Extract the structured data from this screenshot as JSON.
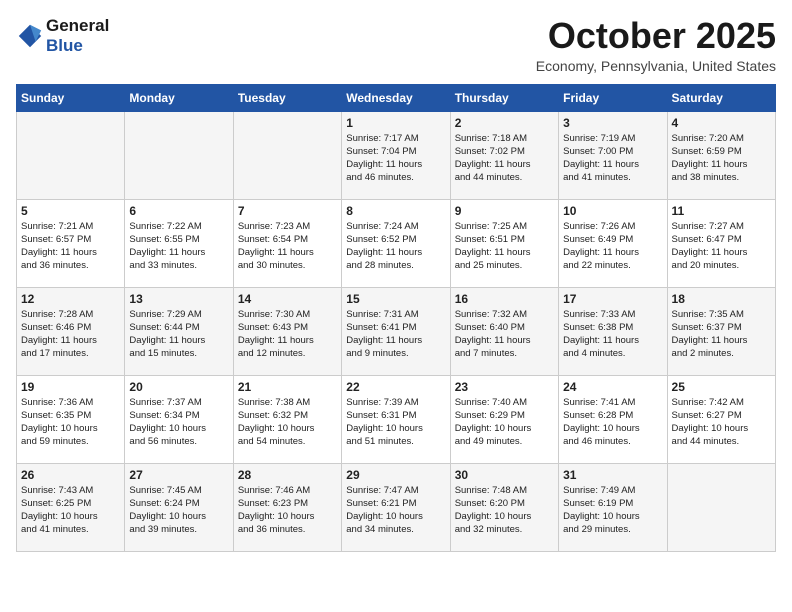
{
  "header": {
    "logo_line1": "General",
    "logo_line2": "Blue",
    "month_title": "October 2025",
    "location": "Economy, Pennsylvania, United States"
  },
  "days_of_week": [
    "Sunday",
    "Monday",
    "Tuesday",
    "Wednesday",
    "Thursday",
    "Friday",
    "Saturday"
  ],
  "weeks": [
    [
      {
        "day": "",
        "info": ""
      },
      {
        "day": "",
        "info": ""
      },
      {
        "day": "",
        "info": ""
      },
      {
        "day": "1",
        "info": "Sunrise: 7:17 AM\nSunset: 7:04 PM\nDaylight: 11 hours\nand 46 minutes."
      },
      {
        "day": "2",
        "info": "Sunrise: 7:18 AM\nSunset: 7:02 PM\nDaylight: 11 hours\nand 44 minutes."
      },
      {
        "day": "3",
        "info": "Sunrise: 7:19 AM\nSunset: 7:00 PM\nDaylight: 11 hours\nand 41 minutes."
      },
      {
        "day": "4",
        "info": "Sunrise: 7:20 AM\nSunset: 6:59 PM\nDaylight: 11 hours\nand 38 minutes."
      }
    ],
    [
      {
        "day": "5",
        "info": "Sunrise: 7:21 AM\nSunset: 6:57 PM\nDaylight: 11 hours\nand 36 minutes."
      },
      {
        "day": "6",
        "info": "Sunrise: 7:22 AM\nSunset: 6:55 PM\nDaylight: 11 hours\nand 33 minutes."
      },
      {
        "day": "7",
        "info": "Sunrise: 7:23 AM\nSunset: 6:54 PM\nDaylight: 11 hours\nand 30 minutes."
      },
      {
        "day": "8",
        "info": "Sunrise: 7:24 AM\nSunset: 6:52 PM\nDaylight: 11 hours\nand 28 minutes."
      },
      {
        "day": "9",
        "info": "Sunrise: 7:25 AM\nSunset: 6:51 PM\nDaylight: 11 hours\nand 25 minutes."
      },
      {
        "day": "10",
        "info": "Sunrise: 7:26 AM\nSunset: 6:49 PM\nDaylight: 11 hours\nand 22 minutes."
      },
      {
        "day": "11",
        "info": "Sunrise: 7:27 AM\nSunset: 6:47 PM\nDaylight: 11 hours\nand 20 minutes."
      }
    ],
    [
      {
        "day": "12",
        "info": "Sunrise: 7:28 AM\nSunset: 6:46 PM\nDaylight: 11 hours\nand 17 minutes."
      },
      {
        "day": "13",
        "info": "Sunrise: 7:29 AM\nSunset: 6:44 PM\nDaylight: 11 hours\nand 15 minutes."
      },
      {
        "day": "14",
        "info": "Sunrise: 7:30 AM\nSunset: 6:43 PM\nDaylight: 11 hours\nand 12 minutes."
      },
      {
        "day": "15",
        "info": "Sunrise: 7:31 AM\nSunset: 6:41 PM\nDaylight: 11 hours\nand 9 minutes."
      },
      {
        "day": "16",
        "info": "Sunrise: 7:32 AM\nSunset: 6:40 PM\nDaylight: 11 hours\nand 7 minutes."
      },
      {
        "day": "17",
        "info": "Sunrise: 7:33 AM\nSunset: 6:38 PM\nDaylight: 11 hours\nand 4 minutes."
      },
      {
        "day": "18",
        "info": "Sunrise: 7:35 AM\nSunset: 6:37 PM\nDaylight: 11 hours\nand 2 minutes."
      }
    ],
    [
      {
        "day": "19",
        "info": "Sunrise: 7:36 AM\nSunset: 6:35 PM\nDaylight: 10 hours\nand 59 minutes."
      },
      {
        "day": "20",
        "info": "Sunrise: 7:37 AM\nSunset: 6:34 PM\nDaylight: 10 hours\nand 56 minutes."
      },
      {
        "day": "21",
        "info": "Sunrise: 7:38 AM\nSunset: 6:32 PM\nDaylight: 10 hours\nand 54 minutes."
      },
      {
        "day": "22",
        "info": "Sunrise: 7:39 AM\nSunset: 6:31 PM\nDaylight: 10 hours\nand 51 minutes."
      },
      {
        "day": "23",
        "info": "Sunrise: 7:40 AM\nSunset: 6:29 PM\nDaylight: 10 hours\nand 49 minutes."
      },
      {
        "day": "24",
        "info": "Sunrise: 7:41 AM\nSunset: 6:28 PM\nDaylight: 10 hours\nand 46 minutes."
      },
      {
        "day": "25",
        "info": "Sunrise: 7:42 AM\nSunset: 6:27 PM\nDaylight: 10 hours\nand 44 minutes."
      }
    ],
    [
      {
        "day": "26",
        "info": "Sunrise: 7:43 AM\nSunset: 6:25 PM\nDaylight: 10 hours\nand 41 minutes."
      },
      {
        "day": "27",
        "info": "Sunrise: 7:45 AM\nSunset: 6:24 PM\nDaylight: 10 hours\nand 39 minutes."
      },
      {
        "day": "28",
        "info": "Sunrise: 7:46 AM\nSunset: 6:23 PM\nDaylight: 10 hours\nand 36 minutes."
      },
      {
        "day": "29",
        "info": "Sunrise: 7:47 AM\nSunset: 6:21 PM\nDaylight: 10 hours\nand 34 minutes."
      },
      {
        "day": "30",
        "info": "Sunrise: 7:48 AM\nSunset: 6:20 PM\nDaylight: 10 hours\nand 32 minutes."
      },
      {
        "day": "31",
        "info": "Sunrise: 7:49 AM\nSunset: 6:19 PM\nDaylight: 10 hours\nand 29 minutes."
      },
      {
        "day": "",
        "info": ""
      }
    ]
  ]
}
